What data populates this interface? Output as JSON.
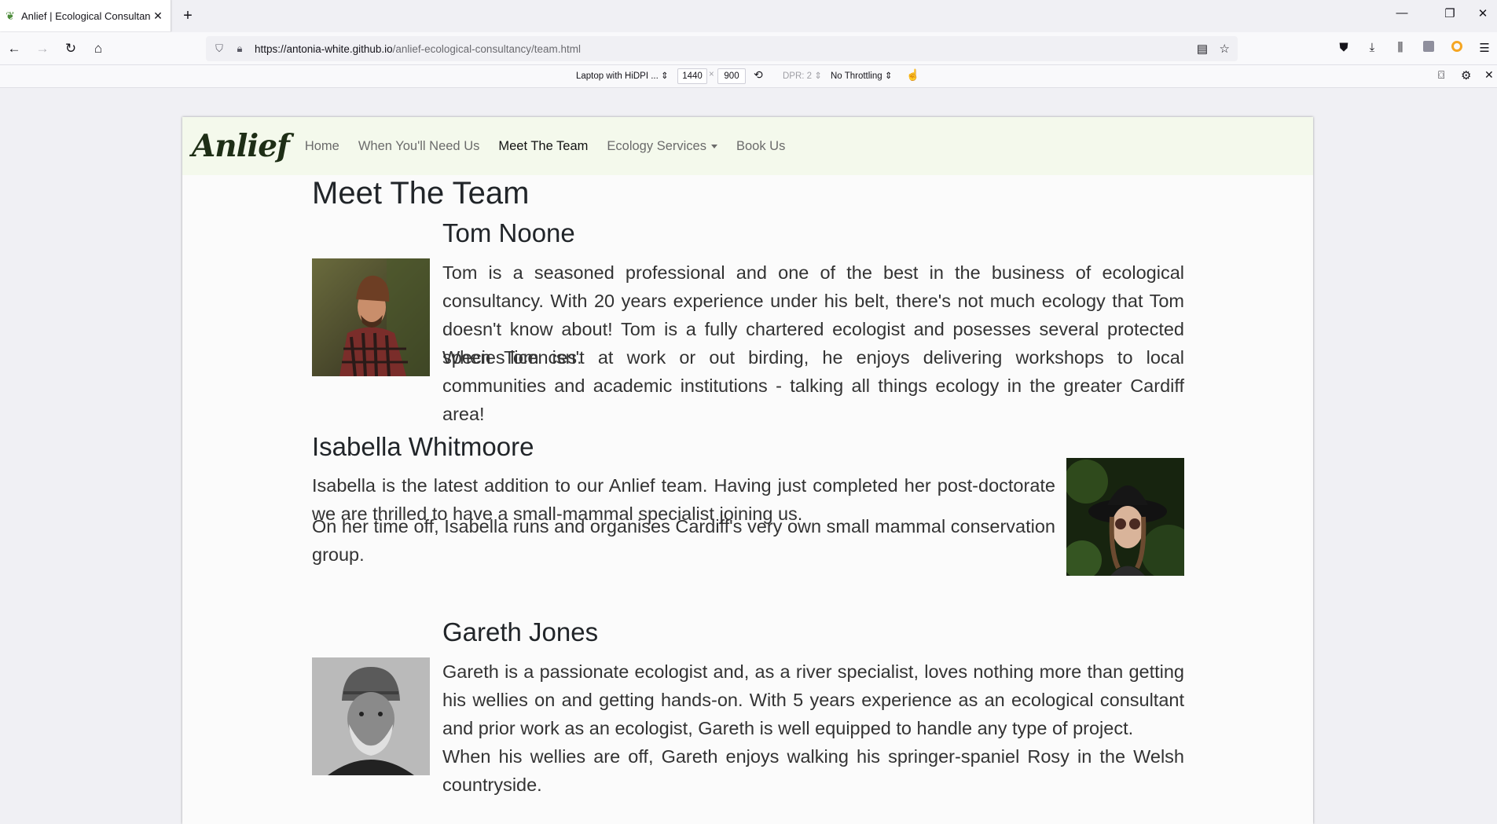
{
  "browser": {
    "tab_title": "Anlief | Ecological Consultancy",
    "url_host": "https://antonia-white.github.io",
    "url_path": "/anlief-ecological-consultancy/team.html"
  },
  "rdm": {
    "device": "Laptop with HiDPI ...",
    "width": "1440",
    "times": "×",
    "height": "900",
    "dpr": "DPR: 2",
    "throttling": "No Throttling"
  },
  "site": {
    "brand": "Anlief",
    "nav": {
      "home": "Home",
      "when": "When You'll Need Us",
      "team": "Meet The Team",
      "services": "Ecology Services",
      "book": "Book Us"
    }
  },
  "page": {
    "title": "Meet The Team",
    "members": [
      {
        "name": "Tom Noone",
        "bio1": "Tom is a seasoned professional and one of the best in the business of ecological consultancy. With 20 years experience under his belt, there's not much ecology that Tom doesn't know about! Tom is a fully chartered ecologist and posesses several protected species licences.",
        "bio2": "When Tom isn't at work or out birding, he enjoys delivering workshops to local communities and academic institutions - talking all things ecology in the greater Cardiff area!"
      },
      {
        "name": "Isabella Whitmoore",
        "bio1": "Isabella is the latest addition to our Anlief team. Having just completed her post-doctorate we are thrilled to have a small-mammal specialist joining us.",
        "bio2": "On her time off, Isabella runs and organises Cardiff's very own small mammal conservation group."
      },
      {
        "name": "Gareth Jones",
        "bio1": "Gareth is a passionate ecologist and, as a river specialist, loves nothing more than getting his wellies on and getting hands-on. With 5 years experience as an ecological consultant and prior work as an ecologist, Gareth is well equipped to handle any type of project.",
        "bio2": "When his wellies are off, Gareth enjoys walking his springer-spaniel Rosy in the Welsh countryside."
      }
    ]
  }
}
